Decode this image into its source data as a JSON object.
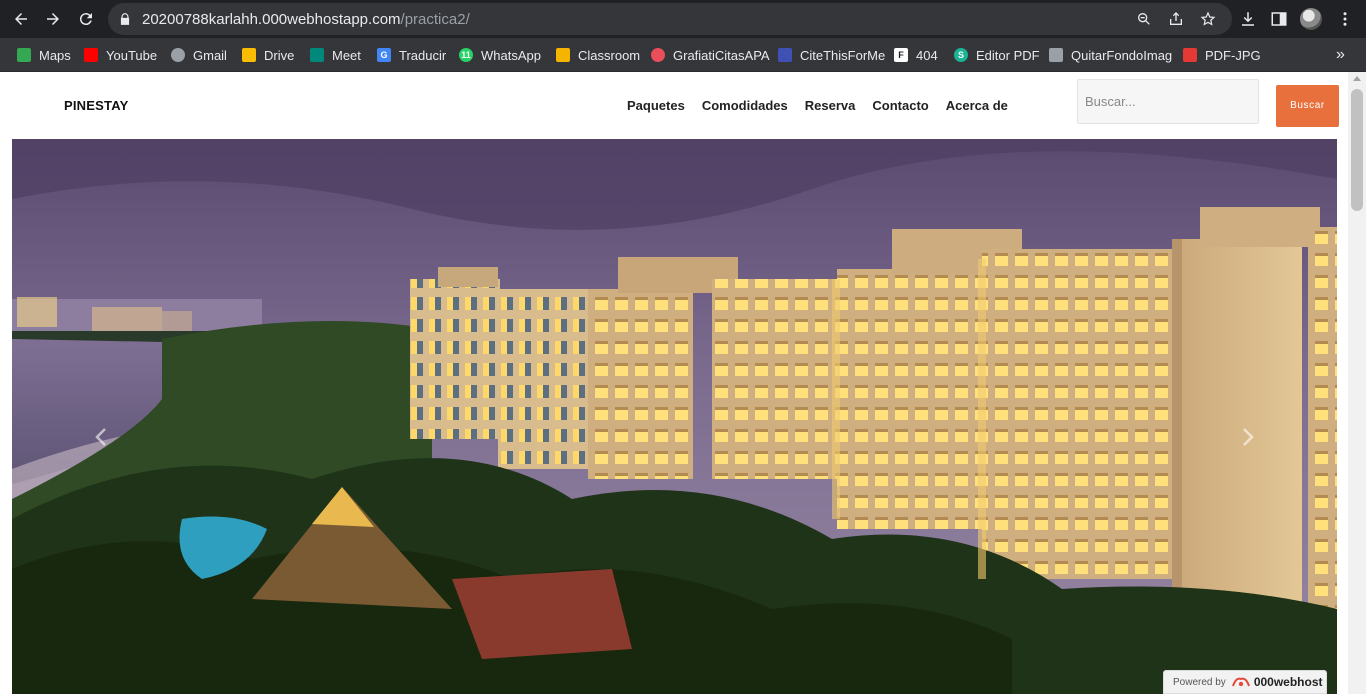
{
  "browser": {
    "url_host": "20200788karlahh.000webhostapp.com",
    "url_path": "/practica2/",
    "bookmarks": [
      {
        "label": "Maps",
        "icon": "maps-icon",
        "color": "#34a853"
      },
      {
        "label": "YouTube",
        "icon": "youtube-icon",
        "color": "#ff0000"
      },
      {
        "label": "Gmail",
        "icon": "globe-icon",
        "color": "#9aa0a6"
      },
      {
        "label": "Drive",
        "icon": "drive-icon",
        "color": "#fbbc04"
      },
      {
        "label": "Meet",
        "icon": "meet-icon",
        "color": "#00897b"
      },
      {
        "label": "Traducir",
        "icon": "translate-icon",
        "color": "#4285f4"
      },
      {
        "label": "WhatsApp",
        "icon": "whatsapp-icon",
        "color": "#25d366"
      },
      {
        "label": "Classroom",
        "icon": "classroom-icon",
        "color": "#f4b400"
      },
      {
        "label": "GrafiatiCitasAPA",
        "icon": "grafiati-icon",
        "color": "#e94e5a"
      },
      {
        "label": "CiteThisForMe",
        "icon": "citethisforme-icon",
        "color": "#3f51b5"
      },
      {
        "label": "404",
        "icon": "404-icon",
        "color": "#ffffff"
      },
      {
        "label": "Editor PDF",
        "icon": "editor-pdf-icon",
        "color": "#1ab394"
      },
      {
        "label": "QuitarFondoImag",
        "icon": "quitarfondo-icon",
        "color": "#9aa0a6"
      },
      {
        "label": "PDF-JPG",
        "icon": "pdf-jpg-icon",
        "color": "#e53935"
      }
    ]
  },
  "site": {
    "brand": "PINESTAY",
    "menu": [
      "Paquetes",
      "Comodidades",
      "Reserva",
      "Contacto",
      "Acerca de"
    ],
    "search": {
      "placeholder": "Buscar...",
      "button_label": "Buscar"
    },
    "accent_color": "#e8703d"
  },
  "hero": {
    "image": "hotel-resort-at-dusk",
    "prev_icon": "chevron-left-icon",
    "next_icon": "chevron-right-icon"
  },
  "footer_badge": {
    "label": "Powered by",
    "brand": "000webhost"
  }
}
